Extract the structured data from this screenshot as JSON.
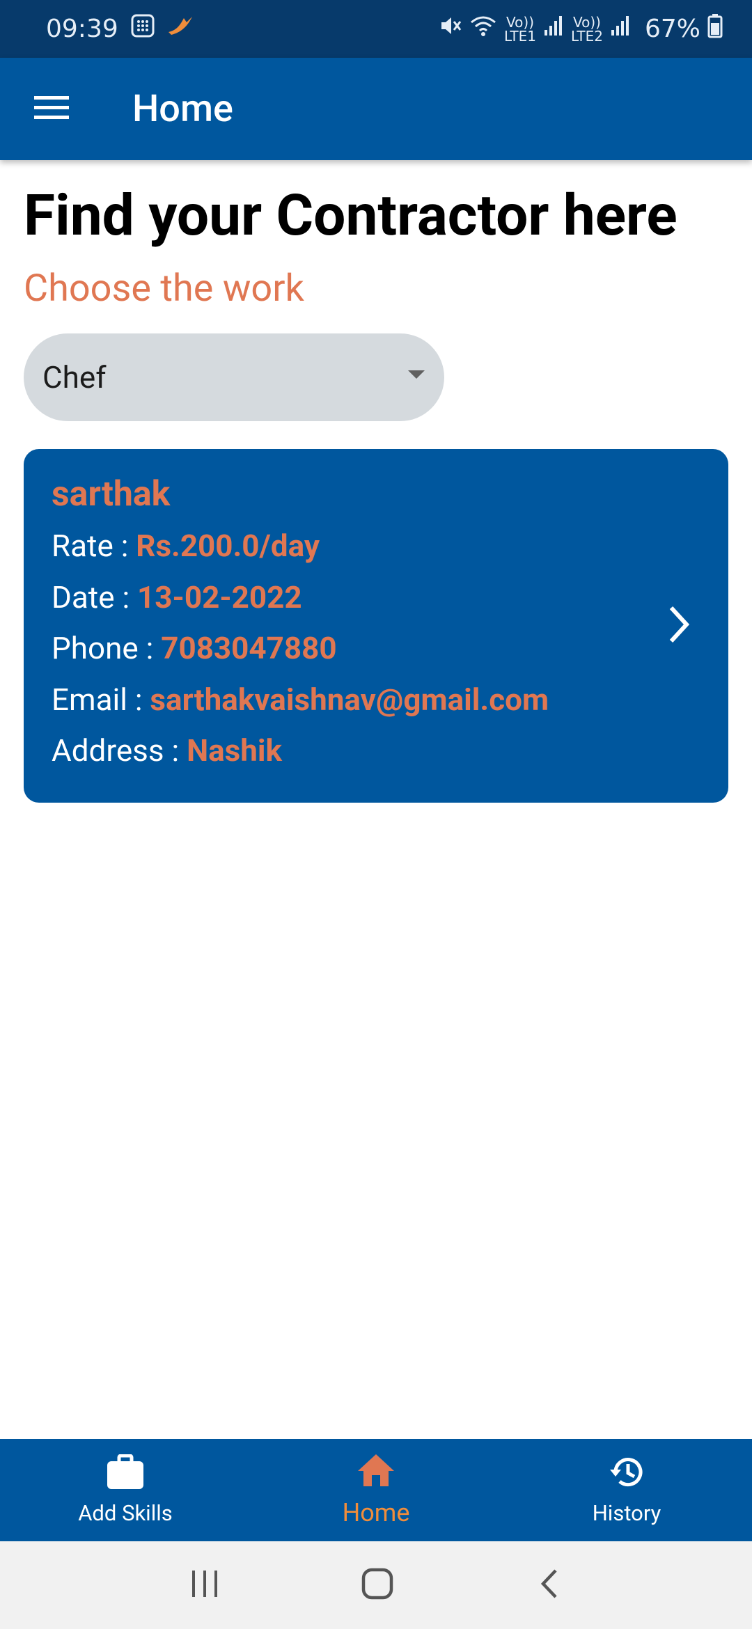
{
  "status_bar": {
    "time": "09:39",
    "network_1_top": "Vo))",
    "network_1_bottom": "LTE1",
    "network_2_top": "Vo))",
    "network_2_bottom": "LTE2",
    "battery": "67%"
  },
  "appbar": {
    "title": "Home"
  },
  "main": {
    "headline": "Find your Contractor here",
    "subheading": "Choose the work",
    "work_select": {
      "value": "Chef"
    }
  },
  "contractor_card": {
    "name": "sarthak",
    "rate_label": "Rate : ",
    "rate_value": "Rs.200.0/day",
    "date_label": "Date : ",
    "date_value": "13-02-2022",
    "phone_label": "Phone : ",
    "phone_value": "7083047880",
    "email_label": "Email : ",
    "email_value": "sarthakvaishnav@gmail.com",
    "address_label": "Address : ",
    "address_value": "Nashik"
  },
  "bottom_nav": {
    "items": [
      {
        "label": "Add Skills",
        "icon": "briefcase-icon"
      },
      {
        "label": "Home",
        "icon": "home-icon",
        "active": true
      },
      {
        "label": "History",
        "icon": "history-icon"
      }
    ]
  },
  "colors": {
    "primary": "#00579e",
    "status_bar": "#073a6b",
    "accent": "#e07752",
    "active_nav": "#f08d3b",
    "dropdown_bg": "#d5dade"
  }
}
